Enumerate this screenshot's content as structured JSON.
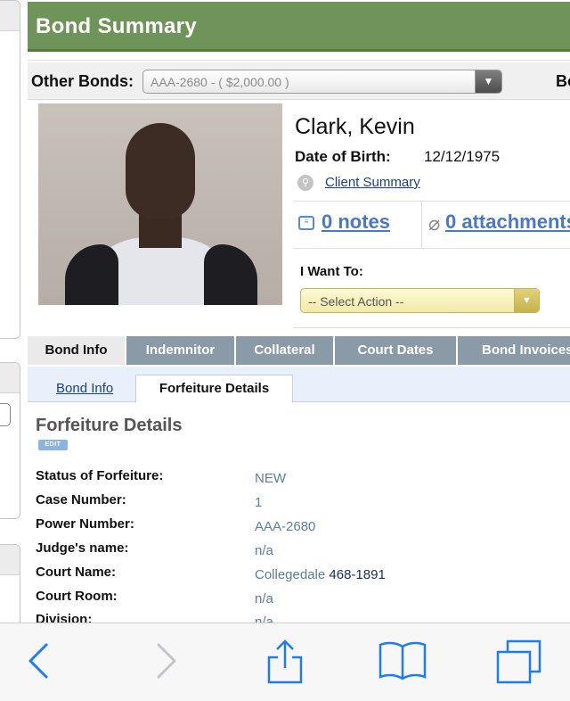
{
  "header": {
    "title": "Bond Summary"
  },
  "other_bonds": {
    "label": "Other Bonds:",
    "selected": "AAA-2680 - ( $2,000.00 )",
    "extra_label": "Bo"
  },
  "client": {
    "name": "Clark, Kevin",
    "dob_label": "Date of Birth:",
    "dob": "12/12/1975",
    "summary_link": "Client Summary",
    "notes_link": "0 notes",
    "attachments_link": "0 attachments"
  },
  "actions": {
    "label": "I Want To:",
    "selected": "-- Select Action --"
  },
  "tabs": [
    {
      "label": "Bond Info",
      "active": true
    },
    {
      "label": "Indemnitor",
      "active": false
    },
    {
      "label": "Collateral",
      "active": false
    },
    {
      "label": "Court Dates",
      "active": false
    },
    {
      "label": "Bond Invoices",
      "active": false
    }
  ],
  "subtabs": {
    "link": "Bond Info",
    "active": "Forfeiture Details"
  },
  "forfeiture": {
    "title": "Forfeiture Details",
    "edit_label": "EDIT",
    "rows": [
      {
        "label": "Status of Forfeiture:",
        "value": "NEW"
      },
      {
        "label": "Case Number:",
        "value": "1"
      },
      {
        "label": "Power Number:",
        "value": "AAA-2680"
      },
      {
        "label": "Judge's name:",
        "value": "n/a"
      },
      {
        "label": "Court Name:",
        "value": "Collegedale",
        "phone": "468-1891"
      },
      {
        "label": "Court Room:",
        "value": "n/a"
      },
      {
        "label": "Division:",
        "value": "n/a"
      }
    ]
  },
  "browser_toolbar": {
    "icons": [
      "back-icon",
      "forward-icon",
      "share-icon",
      "bookmarks-icon",
      "tabs-icon"
    ]
  }
}
